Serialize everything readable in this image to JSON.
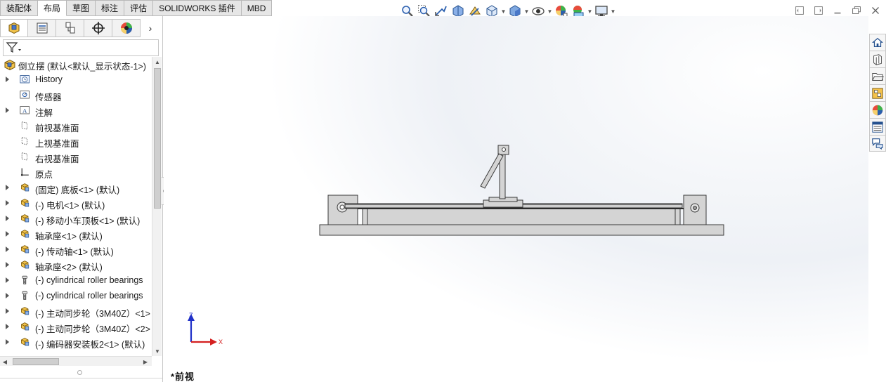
{
  "tabs": [
    "装配体",
    "布局",
    "草图",
    "标注",
    "评估",
    "SOLIDWORKS 插件",
    "MBD"
  ],
  "active_tab": "布局",
  "hud_icons": [
    {
      "name": "zoom-to-fit-icon",
      "caret": false
    },
    {
      "name": "zoom-to-area-icon",
      "caret": false
    },
    {
      "name": "previous-view-icon",
      "caret": false
    },
    {
      "name": "section-view-icon",
      "caret": false
    },
    {
      "name": "dynamic-annotation-icon",
      "caret": false
    },
    {
      "name": "view-orientation-icon",
      "caret": true
    },
    {
      "name": "display-style-icon",
      "caret": true
    },
    {
      "name": "hide-show-items-icon",
      "caret": true
    },
    {
      "name": "edit-appearance-icon",
      "caret": false
    },
    {
      "name": "apply-scene-icon",
      "caret": true
    },
    {
      "name": "view-settings-icon",
      "caret": true
    }
  ],
  "window_controls": [
    "restore-pane-icon",
    "tile-pane-icon",
    "minimize-icon",
    "maximize-icon",
    "close-icon"
  ],
  "panel_tabs": [
    "featuremanager-icon",
    "propertymanager-icon",
    "configurationmanager-icon",
    "dimxpert-icon",
    "displaymanager-icon"
  ],
  "tree": {
    "root": "倒立摆  (默认<默认_显示状态-1>)",
    "items": [
      {
        "label": "History",
        "icon": "history-icon",
        "expander": true
      },
      {
        "label": "传感器",
        "icon": "sensor-icon",
        "expander": false
      },
      {
        "label": "注解",
        "icon": "annotation-icon",
        "expander": true
      },
      {
        "label": "前视基准面",
        "icon": "plane-icon",
        "expander": false
      },
      {
        "label": "上视基准面",
        "icon": "plane-icon",
        "expander": false
      },
      {
        "label": "右视基准面",
        "icon": "plane-icon",
        "expander": false
      },
      {
        "label": "原点",
        "icon": "origin-icon",
        "expander": false
      },
      {
        "label": "(固定) 底板<1> (默认)",
        "icon": "part-icon",
        "expander": true
      },
      {
        "label": "(-) 电机<1> (默认)",
        "icon": "part-icon",
        "expander": true
      },
      {
        "label": "(-) 移动小车顶板<1> (默认)",
        "icon": "part-icon",
        "expander": true
      },
      {
        "label": "轴承座<1> (默认)",
        "icon": "part-icon",
        "expander": true
      },
      {
        "label": "(-) 传动轴<1> (默认)",
        "icon": "part-icon",
        "expander": true
      },
      {
        "label": "轴承座<2> (默认)",
        "icon": "part-icon",
        "expander": true
      },
      {
        "label": "(-) cylindrical roller bearings",
        "icon": "toolbox-part-icon",
        "expander": true
      },
      {
        "label": "(-) cylindrical roller bearings",
        "icon": "toolbox-part-icon",
        "expander": true
      },
      {
        "label": "(-) 主动同步轮（3M40Z）<1>",
        "icon": "part-icon",
        "expander": true
      },
      {
        "label": "(-) 主动同步轮（3M40Z）<2>",
        "icon": "part-icon",
        "expander": true
      },
      {
        "label": "(-) 编码器安装板2<1> (默认)",
        "icon": "part-icon",
        "expander": true
      }
    ]
  },
  "viewport": {
    "view_name": "*前视",
    "triad": {
      "x_label": "X",
      "z_label": "Z"
    }
  },
  "taskpane_icons": [
    "solidworks-resources-icon",
    "design-library-icon",
    "file-explorer-icon",
    "view-palette-icon",
    "appearances-scenes-icon",
    "custom-properties-icon",
    "forum-icon"
  ],
  "colors": {
    "triad_x": "#d42020",
    "triad_z": "#2030c8",
    "part_fill": "#d4d4d4",
    "part_edge": "#3a3a3a"
  }
}
